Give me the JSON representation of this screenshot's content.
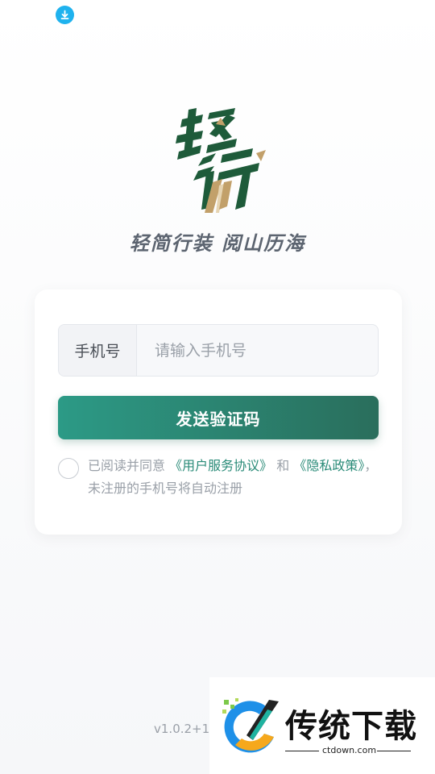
{
  "status_bar": {
    "download_icon": "download-arrow-icon"
  },
  "brand": {
    "logo_text": "轻行",
    "slogan": "轻简行装 阅山历海",
    "colors": {
      "green": "#1e5b3a",
      "gold": "#c2a06a"
    }
  },
  "login": {
    "phone_label": "手机号",
    "phone_placeholder": "请输入手机号",
    "phone_value": "",
    "send_button_label": "发送验证码",
    "agreement": {
      "prefix": "已阅读并同意",
      "user_agreement": "《用户服务协议》",
      "conjunction": "和",
      "privacy_policy": "《隐私政策》",
      "suffix": "，未注册的手机号将自动注册"
    }
  },
  "footer": {
    "version": "v1.0.2+1"
  },
  "watermark": {
    "title": "传统下载",
    "domain": "ctdown.com"
  },
  "accent_colors": {
    "button_start": "#2c9a86",
    "button_end": "#2a6e5c",
    "link": "#2a8b78"
  }
}
